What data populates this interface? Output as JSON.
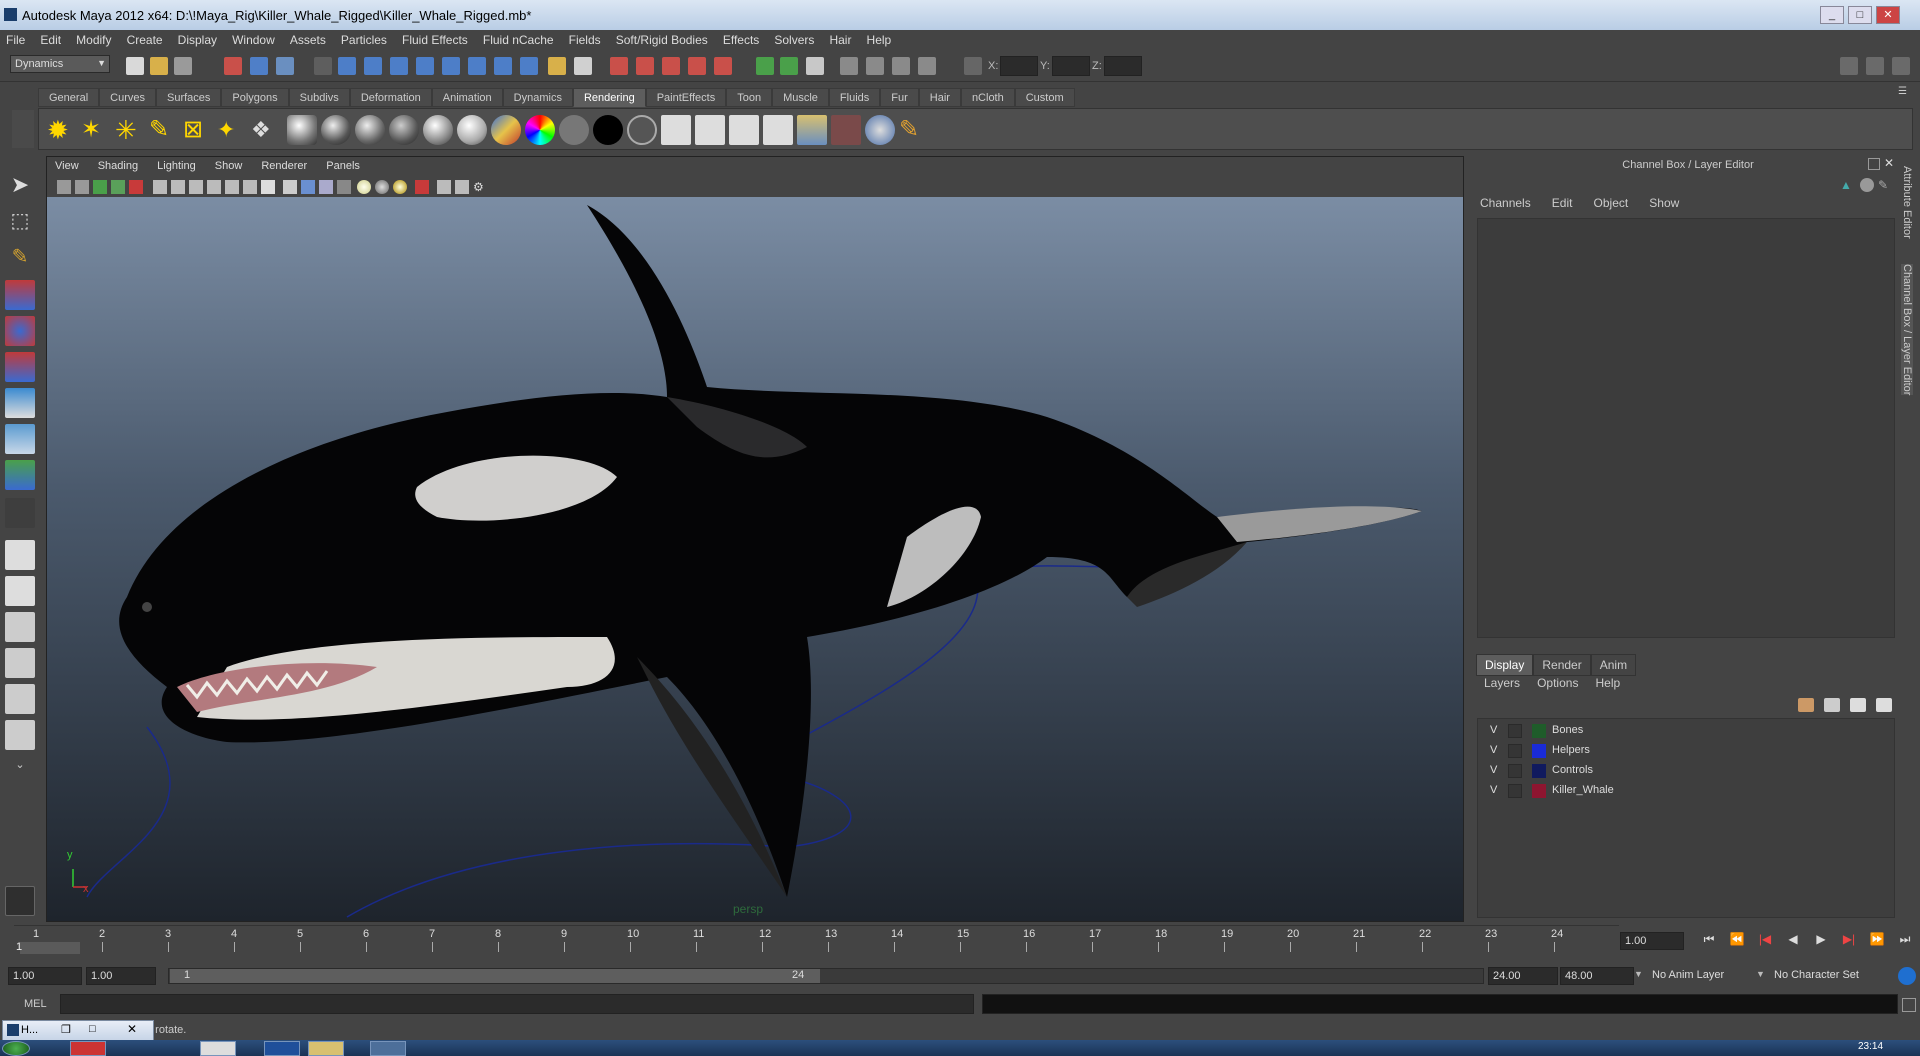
{
  "window": {
    "title": "Autodesk Maya 2012 x64: D:\\!Maya_Rig\\Killer_Whale_Rigged\\Killer_Whale_Rigged.mb*"
  },
  "menubar": {
    "items": [
      "File",
      "Edit",
      "Modify",
      "Create",
      "Display",
      "Window",
      "Assets",
      "Particles",
      "Fluid Effects",
      "Fluid nCache",
      "Fields",
      "Soft/Rigid Bodies",
      "Effects",
      "Solvers",
      "Hair",
      "Help"
    ]
  },
  "statusline": {
    "menuset": "Dynamics",
    "x_label": "X:",
    "y_label": "Y:",
    "z_label": "Z:"
  },
  "shelf": {
    "tabs": [
      "General",
      "Curves",
      "Surfaces",
      "Polygons",
      "Subdivs",
      "Deformation",
      "Animation",
      "Dynamics",
      "Rendering",
      "PaintEffects",
      "Toon",
      "Muscle",
      "Fluids",
      "Fur",
      "Hair",
      "nCloth",
      "Custom"
    ],
    "active_tab": "Rendering"
  },
  "viewport": {
    "menus": [
      "View",
      "Shading",
      "Lighting",
      "Show",
      "Renderer",
      "Panels"
    ],
    "camera_label": "persp",
    "axis_y": "y",
    "axis_x": "x"
  },
  "channel_box": {
    "title": "Channel Box / Layer Editor",
    "menus": [
      "Channels",
      "Edit",
      "Object",
      "Show"
    ]
  },
  "layer_editor": {
    "tabs": [
      "Display",
      "Render",
      "Anim"
    ],
    "active_tab": "Display",
    "menus": [
      "Layers",
      "Options",
      "Help"
    ],
    "layers": [
      {
        "visible": "V",
        "name": "Bones",
        "color": "#1f5c2a"
      },
      {
        "visible": "V",
        "name": "Helpers",
        "color": "#1a2bd6"
      },
      {
        "visible": "V",
        "name": "Controls",
        "color": "#101a5e"
      },
      {
        "visible": "V",
        "name": "Killer_Whale",
        "color": "#8e1530"
      }
    ]
  },
  "side_tabs": {
    "attribute_editor": "Attribute Editor",
    "channel_box": "Channel Box / Layer Editor"
  },
  "timeline": {
    "ticks": [
      "1",
      "2",
      "3",
      "4",
      "5",
      "6",
      "7",
      "8",
      "9",
      "10",
      "11",
      "12",
      "13",
      "14",
      "15",
      "16",
      "17",
      "18",
      "19",
      "20",
      "21",
      "22",
      "23",
      "24"
    ],
    "current_frame": "1",
    "current_time_field": "1.00"
  },
  "range": {
    "start_time": "1.00",
    "playback_start": "1.00",
    "handle_start": "1",
    "handle_end": "24",
    "playback_end": "24.00",
    "end_time": "48.00",
    "anim_layer": "No Anim Layer",
    "character_set": "No Character Set"
  },
  "command": {
    "label": "MEL"
  },
  "help": {
    "text": "o rotate."
  },
  "taskbar": {
    "minimized_label": "H...",
    "clock": "23:14"
  }
}
